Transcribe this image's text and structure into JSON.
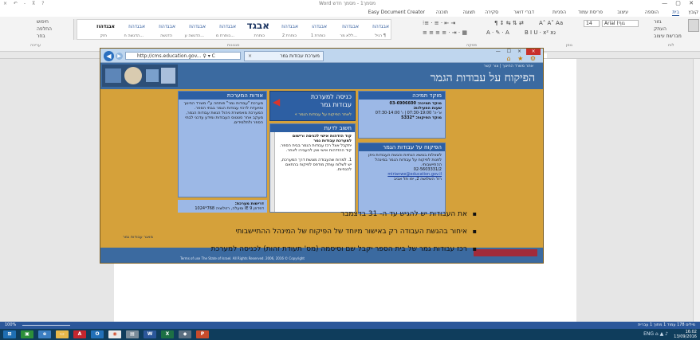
{
  "word": {
    "title": "Word מסמך1 - מסמך חדש",
    "qat": "× ↶ - ⊼ ?",
    "tabs": [
      {
        "label": "קובץ",
        "active": false
      },
      {
        "label": "בית",
        "active": true
      },
      {
        "label": "הוספה",
        "active": false
      },
      {
        "label": "עיצוב",
        "active": false
      },
      {
        "label": "פריסת עמוד",
        "active": false
      },
      {
        "label": "הפניות",
        "active": false
      },
      {
        "label": "דברי דואר",
        "active": false
      },
      {
        "label": "סקירה",
        "active": false
      },
      {
        "label": "תצוגה",
        "active": false
      },
      {
        "label": "תוכנה",
        "active": false
      },
      {
        "label": "Easy Document Creator",
        "active": false
      }
    ],
    "ribbon": {
      "font_name": "Arial (גוף",
      "font_size": "14",
      "styles": [
        {
          "label": "אבגדהוז",
          "sub": "רגיל ¶",
          "kind": "normal"
        },
        {
          "label": "אבגדהוז",
          "sub": "ללא מר...",
          "kind": "normal"
        },
        {
          "label": "אבגדהו",
          "sub": "כותרת 1",
          "kind": "normal"
        },
        {
          "label": "אבגדהוז",
          "sub": "כותרת 2",
          "kind": "normal"
        },
        {
          "label": "אבגד",
          "sub": "כותרת",
          "kind": "big"
        },
        {
          "label": "אבגדהוז",
          "sub": "כותרת מ...",
          "kind": "normal"
        },
        {
          "label": "אבגדהוז",
          "sub": "הדגשה ע...",
          "kind": "normal"
        },
        {
          "label": "אבגדהוז",
          "sub": "הדגשה",
          "kind": "normal"
        },
        {
          "label": "אבגדהוז",
          "sub": "הדגשה ח...",
          "kind": "normal"
        },
        {
          "label": "אבגדהוז",
          "sub": "חזק",
          "kind": "bold"
        },
        {
          "label": "אבגדהוז",
          "sub": "ציטוט",
          "kind": "normal"
        }
      ],
      "group_labels": {
        "clipboard": "לוח",
        "font": "גופן",
        "paragraph": "פסקה",
        "styles": "סגנונות",
        "editing": "עריכה"
      },
      "editing_items": [
        "חיפוש",
        "החלפה",
        "בחר"
      ],
      "clipboard_items": [
        "גזור",
        "העתק",
        "מברשת עיצוב"
      ],
      "paste_label": "הדבק"
    },
    "status_left": "100%",
    "status_right": "מילים 178   עמוד 1 מתוך 1   עברית",
    "bullets": [
      "את העבודות יש להגיש עד ה- 31 בדצמבר",
      "איחור בהגשת העבודה רק באישור מיוחד של הפיקוח של המינהל ההתיישבותי",
      "רכז עבודות גמר של בית הספר יקבל שם וסיסמה (מס' תעודת זהות) לכניסה למערכת"
    ]
  },
  "browser": {
    "address": "http://cms.education.gov... ♀ ▾ C",
    "tab_label": "מערכת עבודות גמר",
    "controls": "— ☐ ×",
    "tools": "⌂ ★ ⚙"
  },
  "site": {
    "title": "הפיקוח על עבודות הגמר",
    "toplink": "אתר משרד החינוך | צור קשר",
    "about": {
      "head": "אודות המערכת",
      "body": "מערכת \"עבודות גמר\" פותחה ע\"י משרד החינוך ומיועדת לרכזי עבודות הגמר בבתי הספר. המערכת מאפשרת ניהול הגשת עבודות הגמר, מעקב אחר סטטוס העבודות ומידע עדכני לבתי הספר ולתלמידים."
    },
    "entry": {
      "line1": "כניסה למערכת",
      "line2": "עבודות גמר",
      "link": "« לאתר הפיקוח על עבודות הגמר"
    },
    "news": {
      "head": "חשוב לדעת",
      "intro": "קוד הזדהות אישי לכניסה ורישום למערכת עבודות גמר",
      "body": "יתקבל אצל רכז עבודות הגמר בבית הספר. קוד ההזדהות אישי ואין להעבירו לאחר.",
      "item": "1. למרות שהעבודה מוגשת דרך המערכת, יש לשלוח עותק מודפס לפיקוח בהתאם להנחיות."
    },
    "hotline": {
      "head": "מוקד תמיכה",
      "phone_label": "מוקד תמיכה:",
      "phone": "03-6906600",
      "hours_label": "שעות הפעילות:",
      "hours": "א'-ה' 07:30-19:00 | ו' 07:30-14:00",
      "ext_label": "מוקד הפיקוח:",
      "ext": "*5332"
    },
    "supervision": {
      "head": "הפיקוח על עבודות הגמר",
      "body": "לשאלות בנושא הנחיות והגשת העבודות ניתן לפנות לפיקוח על עבודות הגמר במינהל ההתיישבותי.",
      "fax": "02-5603331/2",
      "email": "mirianwe@education.gov.il",
      "addr": "רח' השלושה 2, יפו תל אביב"
    },
    "requirements": {
      "label": "דרישות מערכת:",
      "body": "דפדפן IE 9 ומעלה, רזולוציה 768*1024"
    },
    "footer_note": "מאגר עבודות גמר",
    "footer_terms": "Terms of use The State of Israel. All Rights Reserved. 2006, 2016 © Copyright"
  },
  "taskbar": {
    "time": "16:02",
    "date": "13/09/2016",
    "tray": "ENG ⌂ ▲ ♪"
  },
  "colors": {
    "word_blue": "#2b579a",
    "site_blue": "#2d5fa3",
    "site_bg": "#d5a13a",
    "card_bg": "#9cb8e6",
    "taskbar": "#0f3d5c"
  }
}
